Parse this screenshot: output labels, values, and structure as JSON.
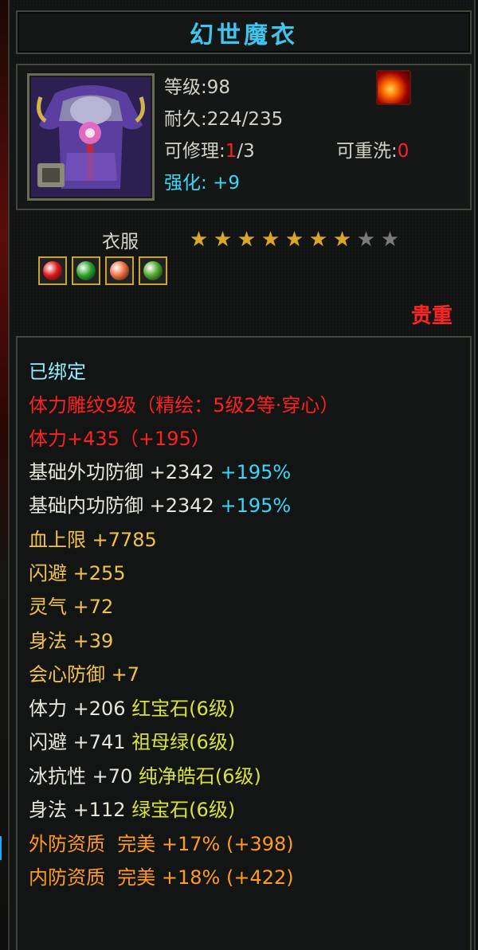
{
  "item": {
    "name": "幻世魔衣",
    "level": "等级:98",
    "durability": "耐久:224/235",
    "repair_label": "可修理:",
    "repair_value": "1",
    "repair_total": "/3",
    "rewash_label": "可重洗:",
    "rewash_value": "0",
    "enhance_label": "强化:",
    "enhance_value": "+9",
    "slot": "衣服",
    "rarity": "贵重",
    "stars_filled": 7,
    "stars_total": 9,
    "gem_colors": [
      "#e01818",
      "#2aa52a",
      "#f07040",
      "#4fa82a"
    ]
  },
  "attributes": {
    "bound": "已绑定",
    "engrave": "体力雕纹9级（精绘：5级2等·穿心）",
    "stamina_base": "体力+435（+195）",
    "ext_def_label": "基础外功防御",
    "ext_def_value": "+2342",
    "ext_def_pct": "+195%",
    "int_def_label": "基础内功防御",
    "int_def_value": "+2342",
    "int_def_pct": "+195%",
    "hp_max": "血上限 +7785",
    "dodge": "闪避 +255",
    "spirit": "灵气 +72",
    "agility": "身法 +39",
    "crit_def": "会心防御 +7",
    "gem1_stat": "体力 +206",
    "gem1_name": "红宝石(6级)",
    "gem2_stat": "闪避 +741",
    "gem2_name": "祖母绿(6级)",
    "gem3_stat": "冰抗性 +70",
    "gem3_name": "纯净皓石(6级)",
    "gem4_stat": "身法 +112",
    "gem4_name": "绿宝石(6级)",
    "ext_quality": "外防资质  完美 +17% (+398)",
    "int_quality": "内防资质  完美 +18% (+422)"
  },
  "colors": {
    "title": "#3fc6ee",
    "red": "#ff2020",
    "yellow": "#f0c24a",
    "cyan": "#37d8f8",
    "orange": "#ff9c1a",
    "lime": "#d9e43a",
    "star_on": "#d9a829"
  }
}
